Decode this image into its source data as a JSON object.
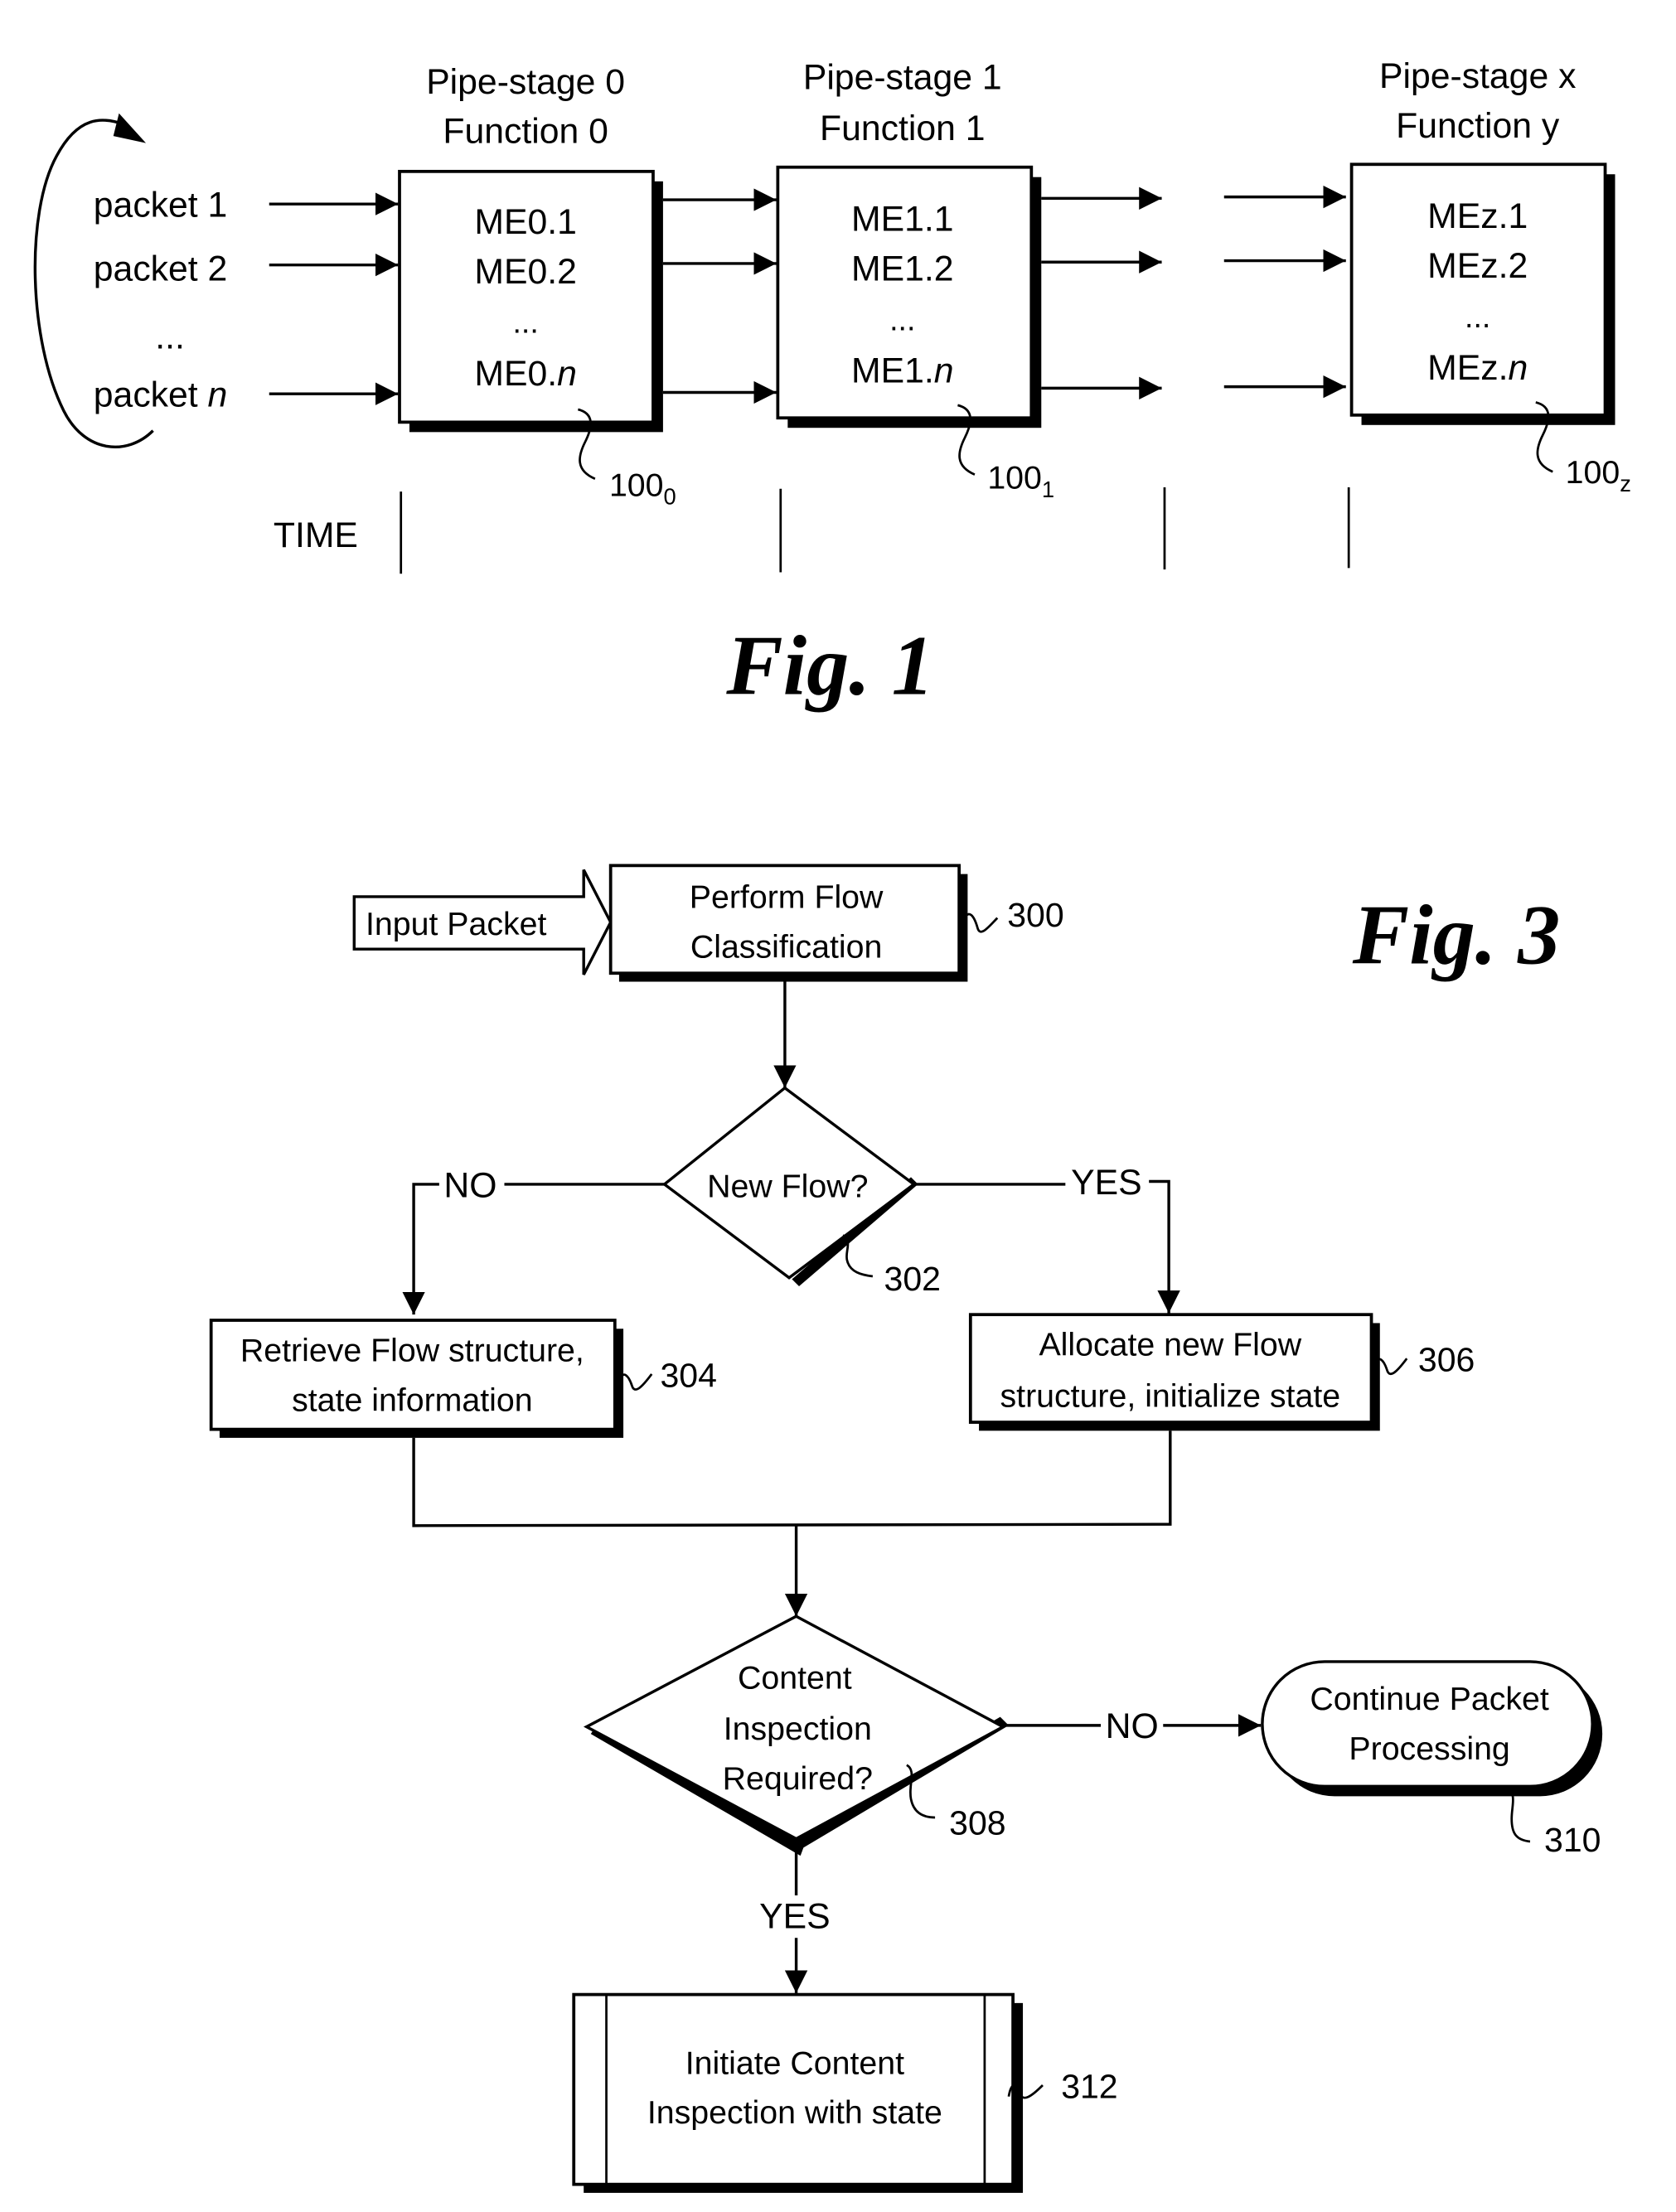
{
  "fig1": {
    "caption": "Fig. 1",
    "packets": [
      {
        "prefix": "packet ",
        "suffix": "1",
        "italic": false
      },
      {
        "prefix": "packet ",
        "suffix": "2",
        "italic": false
      },
      {
        "prefix": "packet ",
        "suffix": "n",
        "italic": true
      }
    ],
    "packets_ellipsis": "...",
    "time_label": "TIME",
    "stages": [
      {
        "title_line1": "Pipe-stage 0",
        "title_line2": "Function 0",
        "items": [
          "ME0.1",
          "ME0.2"
        ],
        "ellipsis": "...",
        "last_prefix": "ME0.",
        "last_suffix": "n",
        "ref_base": "100",
        "ref_sub": "0"
      },
      {
        "title_line1": "Pipe-stage 1",
        "title_line2": "Function 1",
        "items": [
          "ME1.1",
          "ME1.2"
        ],
        "ellipsis": "...",
        "last_prefix": "ME1.",
        "last_suffix": "n",
        "ref_base": "100",
        "ref_sub": "1"
      },
      {
        "title_line1": "Pipe-stage x",
        "title_line2": "Function y",
        "items_prefix": "ME",
        "items": [
          "z.1",
          "z.2"
        ],
        "ellipsis": "...",
        "last_prefix": "MEz.",
        "last_suffix": "n",
        "ref_base": "100",
        "ref_sub": "z"
      }
    ]
  },
  "fig3": {
    "caption": "Fig. 3",
    "input_label": "Input Packet",
    "nodes": {
      "n300": {
        "lines": [
          "Perform Flow",
          "Classification"
        ],
        "ref": "300"
      },
      "n302": {
        "lines": [
          "New Flow?"
        ],
        "ref": "302"
      },
      "n304": {
        "lines": [
          "Retrieve Flow structure,",
          "state information"
        ],
        "ref": "304"
      },
      "n306": {
        "lines": [
          "Allocate new Flow",
          "structure, initialize state"
        ],
        "ref": "306"
      },
      "n308": {
        "lines": [
          "Content",
          "Inspection",
          "Required?"
        ],
        "ref": "308"
      },
      "n310": {
        "lines": [
          "Continue Packet",
          "Processing"
        ],
        "ref": "310"
      },
      "n312": {
        "lines": [
          "Initiate Content",
          "Inspection with state"
        ],
        "ref": "312"
      }
    },
    "edge_labels": {
      "n302_no": "NO",
      "n302_yes": "YES",
      "n308_no": "NO",
      "n308_yes": "YES"
    }
  }
}
